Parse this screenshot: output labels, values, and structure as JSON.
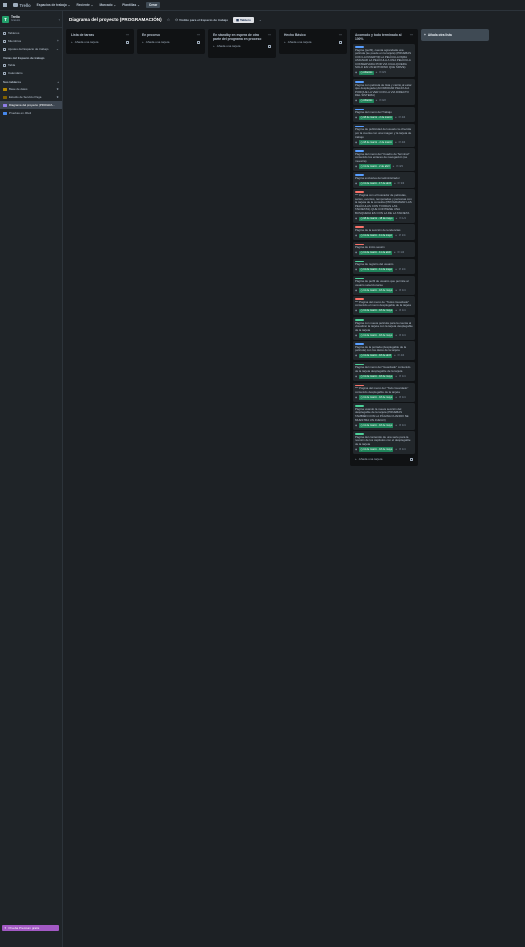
{
  "topbar": {
    "app_name": "Trello",
    "nav": [
      "Espacios de trabajo",
      "Reciente",
      "Marcado",
      "Plantillas"
    ],
    "create_label": "Crear"
  },
  "sidebar": {
    "workspace_initial": "T",
    "workspace_name": "Trello",
    "workspace_sub": "Gratuito",
    "top_items": [
      {
        "label": "Tableros",
        "icon": "board-icon"
      },
      {
        "label": "Miembros",
        "icon": "members-icon"
      },
      {
        "label": "Ajustes del Espacio de trabajo",
        "icon": "gear-icon"
      }
    ],
    "views_section": "Vistas del Espacio de trabajo",
    "view_items": [
      {
        "label": "Tabla",
        "icon": "table-icon"
      },
      {
        "label": "Calendario",
        "icon": "calendar-icon"
      }
    ],
    "boards_section": "Sus tableros",
    "boards": [
      {
        "label": "Base de datos",
        "color": "#b38600"
      },
      {
        "label": "Estudio de Servicio Paga",
        "color": "#7f5f01"
      },
      {
        "label": "Diagrama del proyecto (PROGRA...",
        "color": "#8f7ee7"
      },
      {
        "label": "Pruebas en JDeli",
        "color": "#4688ec"
      }
    ],
    "premium_label": "Prueba Premium gratis"
  },
  "board": {
    "title": "Diagrama del proyecto (PROGRAMACIÓN)",
    "visibility": "Visible para el Espacio de trabajo",
    "view_tab": "Tablero"
  },
  "lists": [
    {
      "title": "Lista de tareas",
      "add_label": "Añada una tarjeta",
      "cards": []
    },
    {
      "title": "En proceso",
      "add_label": "Añada una tarjeta",
      "cards": []
    },
    {
      "title": "En standby en espera de otra parte del programa en proceso",
      "add_label": "Añada una tarjeta",
      "cards": []
    },
    {
      "title": "Hecho Básico",
      "add_label": "Añada una tarjeta",
      "cards": []
    },
    {
      "title": "Acomodo y todo terminado al 100%",
      "add_label": "Añada una tarjeta",
      "cards": [
        {
          "label_color": "#579dff",
          "text": "Página (perfil), cuenta agrandada una película (se puede en la tarjeta) (PRUEBAS CON LA INVERTIR LA PELÍCULA PARA ASIGNAR LA PELÍCULA A UNA PELÍCULA CONSERVADA POR VIA CUALQUIERA SOLO EN UN ENTORNO QUE SIRVE)",
          "due": "Abiertos",
          "count": "0/3"
        },
        {
          "label_color": "#579dff",
          "text": "Página con película de lista y carrito al estar que desplegada (ACOMODAR PELÍCULA PORQUE LA VER CON LA VIA DIRECTO DEL SISTEMA)",
          "due": "Abiertos",
          "count": "0/2"
        },
        {
          "label_color": "#579dff",
          "text": "Página del menú del Trabajo",
          "due": "18 de marzo - 2 de marzo",
          "count": "4/4"
        },
        {
          "label_color": "#579dff",
          "text": "Página de publicidad del usuario la ofrecida por la cuenta con una imagen y la tarjeta de trabajo",
          "due": "18 de marzo - 2 de marzo",
          "count": "4/4"
        },
        {
          "label_color": "#579dff",
          "text": "Página del menú del \"Cuadro de Terminal\" contenido los enlaces de navegación (se muestra)",
          "due": "11 de marzo - 2 de abril",
          "count": "3/3"
        },
        {
          "label_color": "#579dff",
          "text": "Página exclusiva del administrador",
          "due": "11 de marzo - 17 de abril",
          "count": "3/3"
        },
        {
          "label_color": "#f87168",
          "text": "*** Página con el buscador de películas, series, eventos, temporadas y personas con la tarjeta de la consulta (PROGRAMAR LAS PELÍCULAS CON TOODAS LAS TARJETAS) QUE CONTIENE UNA BUSQUEDA ES CON LA DE LA TARJETA",
          "due": "18 de marzo - 18 de mayo",
          "count": "1/4"
        },
        {
          "label_color": "#f87168",
          "text": "Página de la sección de tendencias",
          "due": "11 de marzo - 11 de mayo",
          "count": "1/4"
        },
        {
          "label_color": "#f87168",
          "text": "Página de inicio sesión",
          "due": "11 de marzo - 11 de abril",
          "count": "1/4"
        },
        {
          "label_color": "#4bce97",
          "text": "Página de registro del usuario",
          "due": "11 de marzo - 11 de mayo",
          "count": "1/4"
        },
        {
          "label_color": "#4bce97",
          "text": "Página de perfil de usuario que permite al usuario seleccionarse",
          "due": "11 de marzo - 18 de mayo",
          "count": "1/4"
        },
        {
          "label_color": "#f87168",
          "text": "*** Página del menú de \"Todos Guardado\" contenido el menú desplegable de la tarjeta",
          "due": "11 de marzo - 18 de mayo",
          "count": "1/4"
        },
        {
          "label_color": "#4bce97",
          "text": "Página con nueva película para la cuenta al visualizar la tarjeta con la tarjeta desplegable de la tarjeta",
          "due": "11 de marzo - 18 de mayo",
          "count": "1/4"
        },
        {
          "label_color": "#579dff",
          "text": "Página de la portada (desplegable de la película) con los datos de la tarjeta",
          "due": "11 de marzo - 18 de abril",
          "count": "4/4"
        },
        {
          "label_color": "#4bce97",
          "text": "Página del menú del \"Guardado\" contenido de la tarjeta desplegable de la tarjeta",
          "due": "11 de marzo - 18 de mayo",
          "count": "1/4"
        },
        {
          "label_color": "#f87168",
          "text": "*** Página del menú del \"Todo Guardado\" contenido desplegable de la tarjeta",
          "due": "11 de marzo - 18 de mayo",
          "count": "1/4"
        },
        {
          "label_color": "#4bce97",
          "text": "Página usando la nueva sección del desplegable de la tarjeta (PRUEBAS TAMBIÉN CON LA PÁGINA CUANDO SE MUESTRA UN JUEGO)",
          "due": "11 de marzo - 18 de mayo",
          "count": "1/4"
        },
        {
          "label_color": "#4bce97",
          "text": "Página del contenido de una serie para la reunión de los capítulos con el desplegable de la tarjeta",
          "due": "11 de marzo - 18 de mayo",
          "count": "1/4"
        }
      ]
    }
  ],
  "add_list_label": "Añada otra lista"
}
